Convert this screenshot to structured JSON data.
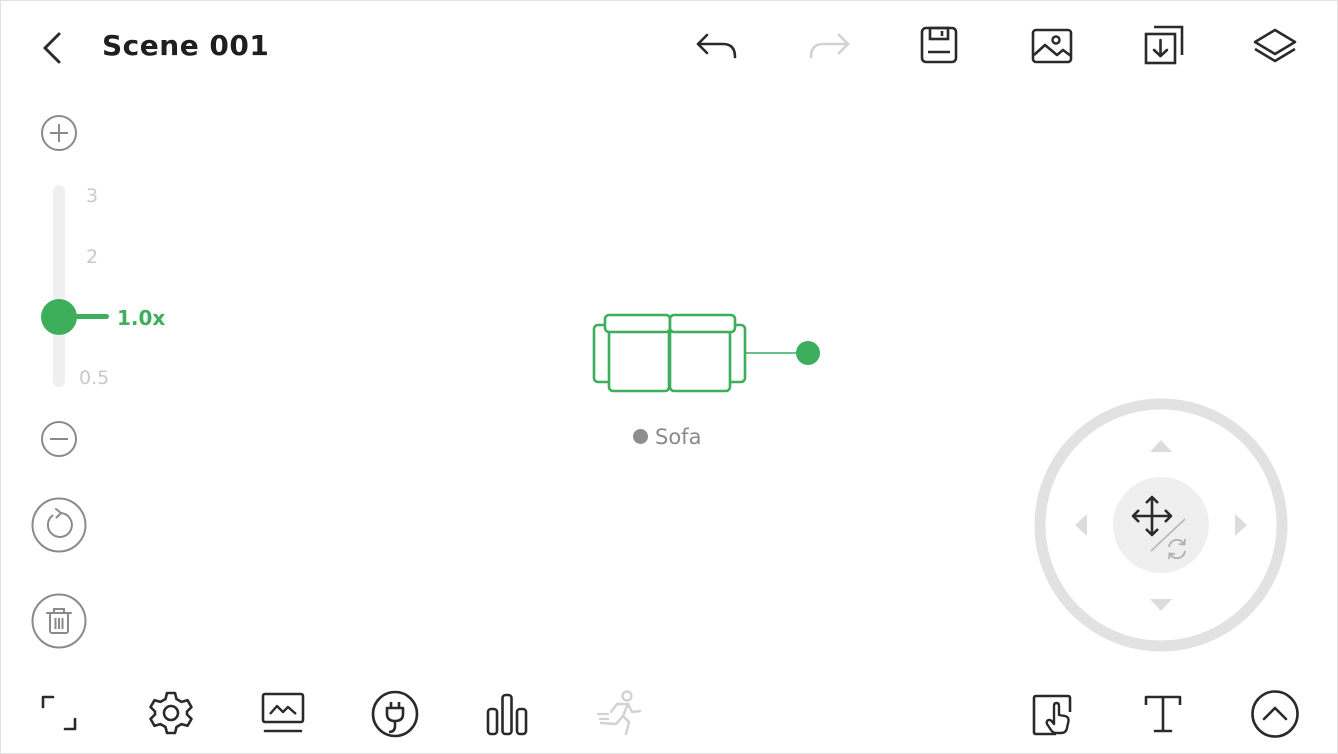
{
  "header": {
    "back_icon": "chevron-left-icon",
    "title": "Scene 001",
    "tools": [
      {
        "name": "undo-icon",
        "enabled": true
      },
      {
        "name": "redo-icon",
        "enabled": false
      },
      {
        "name": "save-icon",
        "enabled": true
      },
      {
        "name": "image-icon",
        "enabled": true
      },
      {
        "name": "import-icon",
        "enabled": true
      },
      {
        "name": "layers-icon",
        "enabled": true
      }
    ]
  },
  "zoom": {
    "ticks": [
      "3",
      "2",
      "0.5"
    ],
    "current": "1.0x",
    "level": 1.0
  },
  "canvas": {
    "object_label": "Sofa",
    "object_icon": "sofa-icon"
  },
  "side_actions": [
    "zoom-in-icon",
    "zoom-out-icon",
    "rotate-icon",
    "trash-icon"
  ],
  "joystick": {
    "mode_icons": [
      "move-icon",
      "rotate-mode-icon"
    ]
  },
  "bottom_toolbar": {
    "left": [
      "fullscreen-icon",
      "settings-icon",
      "monitor-icon",
      "power-plug-icon",
      "bar-chart-icon",
      "running-icon"
    ],
    "right": [
      "touch-select-icon",
      "text-icon",
      "expand-up-icon"
    ]
  },
  "colors": {
    "accent": "#3cae5c",
    "icon": "#2a2a2a",
    "disabled": "#cfcfcf",
    "muted": "#8a8a8a"
  }
}
